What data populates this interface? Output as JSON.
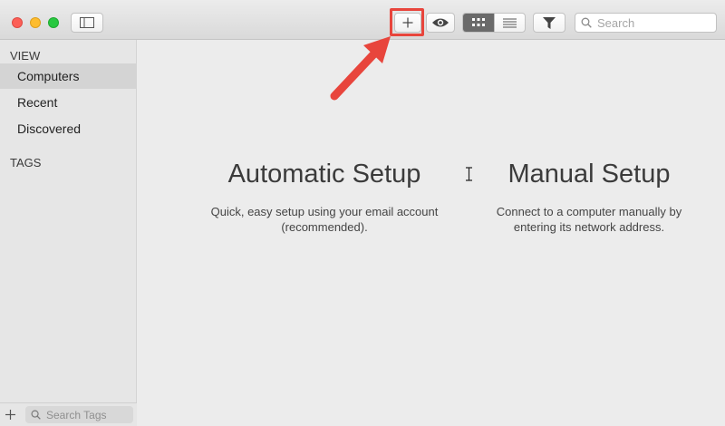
{
  "toolbar": {
    "search_placeholder": "Search"
  },
  "sidebar": {
    "view_title": "VIEW",
    "items": [
      {
        "label": "Computers",
        "selected": true
      },
      {
        "label": "Recent",
        "selected": false
      },
      {
        "label": "Discovered",
        "selected": false
      }
    ],
    "tags_title": "TAGS",
    "tag_search_placeholder": "Search Tags"
  },
  "main": {
    "automatic": {
      "title": "Automatic Setup",
      "description": "Quick, easy setup using your email account (recommended)."
    },
    "manual": {
      "title": "Manual Setup",
      "description": "Connect to a computer manually by entering its network address."
    }
  },
  "colors": {
    "highlight": "#e8453c",
    "close": "#fc5f57",
    "minimize": "#fdbc2e",
    "maximize": "#28c840",
    "active_segment": "#6a6a6a"
  },
  "icons": {
    "add": "plus-icon",
    "preview": "eye-icon",
    "grid_view": "grid-icon",
    "list_view": "list-icon",
    "filter": "funnel-icon",
    "search": "magnifier-icon"
  }
}
